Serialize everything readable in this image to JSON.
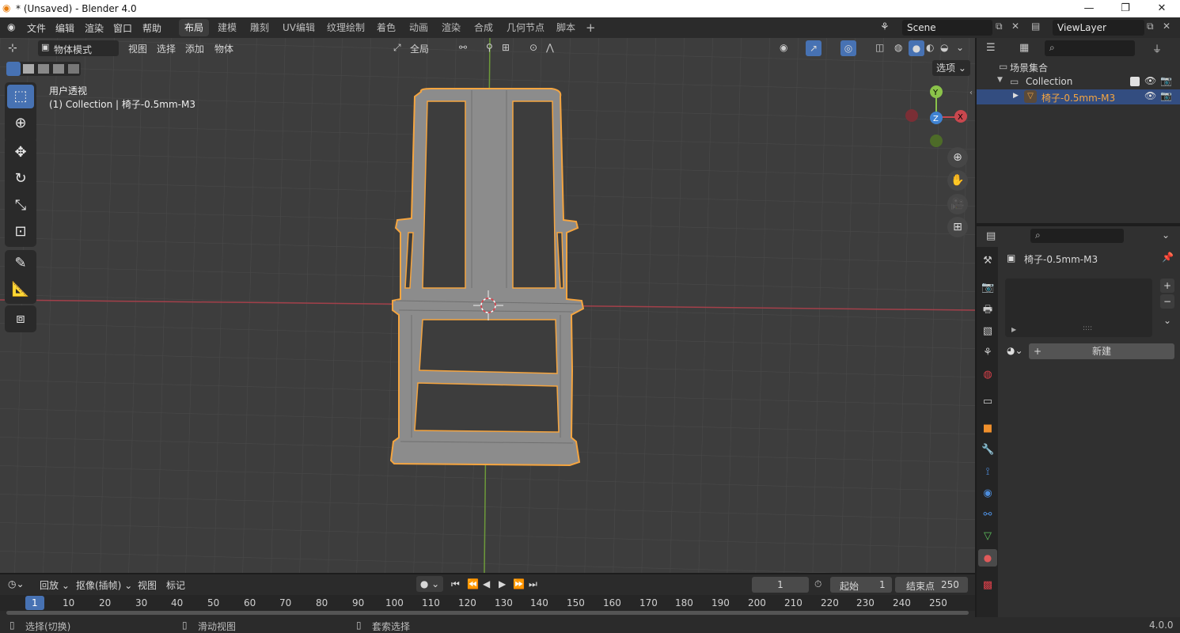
{
  "window": {
    "title": "* (Unsaved) - Blender 4.0",
    "minimize": "—",
    "maximize": "❐",
    "close": "✕"
  },
  "menus": [
    "文件",
    "编辑",
    "渲染",
    "窗口",
    "帮助"
  ],
  "workspaces": [
    "布局",
    "建模",
    "雕刻",
    "UV编辑",
    "纹理绘制",
    "着色",
    "动画",
    "渲染",
    "合成",
    "几何节点",
    "脚本"
  ],
  "active_workspace": "布局",
  "add_workspace": "+",
  "scene": {
    "name": "Scene",
    "view_layer": "ViewLayer"
  },
  "viewport_header": {
    "mode": "物体模式",
    "menus": [
      "视图",
      "选择",
      "添加",
      "物体"
    ],
    "transform_orientation": "全局",
    "options": "选项"
  },
  "viewport": {
    "view_name": "用户透视",
    "collection_info": "(1) Collection | 椅子-0.5mm-M3",
    "gizmo": {
      "y": "Y",
      "x": "X",
      "z": "Z"
    }
  },
  "outliner": {
    "scene_collection": "场景集合",
    "collection": "Collection",
    "object": "椅子-0.5mm-M3"
  },
  "properties": {
    "object_name": "椅子-0.5mm-M3",
    "new_button": "新建",
    "list_handle": "::::"
  },
  "timeline": {
    "menus": [
      "回放",
      "抠像(插帧)",
      "视图",
      "标记"
    ],
    "current_frame": "1",
    "start_label": "起始",
    "start": "1",
    "end_label": "结束点",
    "end": "250",
    "ruler": [
      "1",
      "10",
      "20",
      "30",
      "40",
      "50",
      "60",
      "70",
      "80",
      "90",
      "100",
      "110",
      "120",
      "130",
      "140",
      "150",
      "160",
      "170",
      "180",
      "190",
      "200",
      "210",
      "220",
      "230",
      "240",
      "250"
    ]
  },
  "statusbar": {
    "select": "选择(切换)",
    "pan": "滑动视图",
    "lasso": "套索选择",
    "version": "4.0.0"
  },
  "colors": {
    "accent": "#4772b3",
    "selection": "#f5a540",
    "x_axis": "#c8474e",
    "y_axis": "#8bc34a",
    "z_axis": "#3f82d1"
  }
}
